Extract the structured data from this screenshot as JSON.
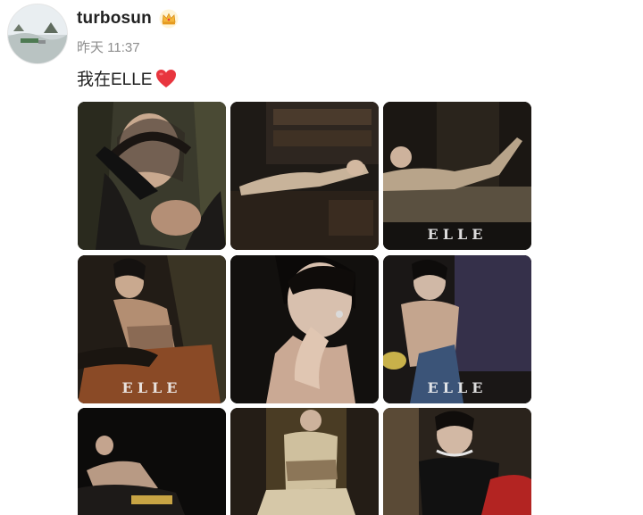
{
  "post": {
    "username": "turbosun",
    "timestamp": "昨天 11:37",
    "text": "我在ELLE",
    "emoji": "red-heart-icon",
    "badge": "crown-icon"
  },
  "photos": [
    {
      "name": "photo-1",
      "watermark": ""
    },
    {
      "name": "photo-2",
      "watermark": ""
    },
    {
      "name": "photo-3",
      "watermark": "ELLE"
    },
    {
      "name": "photo-4",
      "watermark": "ELLE"
    },
    {
      "name": "photo-5",
      "watermark": ""
    },
    {
      "name": "photo-6",
      "watermark": "ELLE"
    },
    {
      "name": "photo-7",
      "watermark": ""
    },
    {
      "name": "photo-8",
      "watermark": ""
    },
    {
      "name": "photo-9",
      "watermark": ""
    }
  ],
  "colors": {
    "username": "#222222",
    "timestamp": "#8d8d8d",
    "heart": "#e8353e",
    "crown": "#f4b63a"
  }
}
